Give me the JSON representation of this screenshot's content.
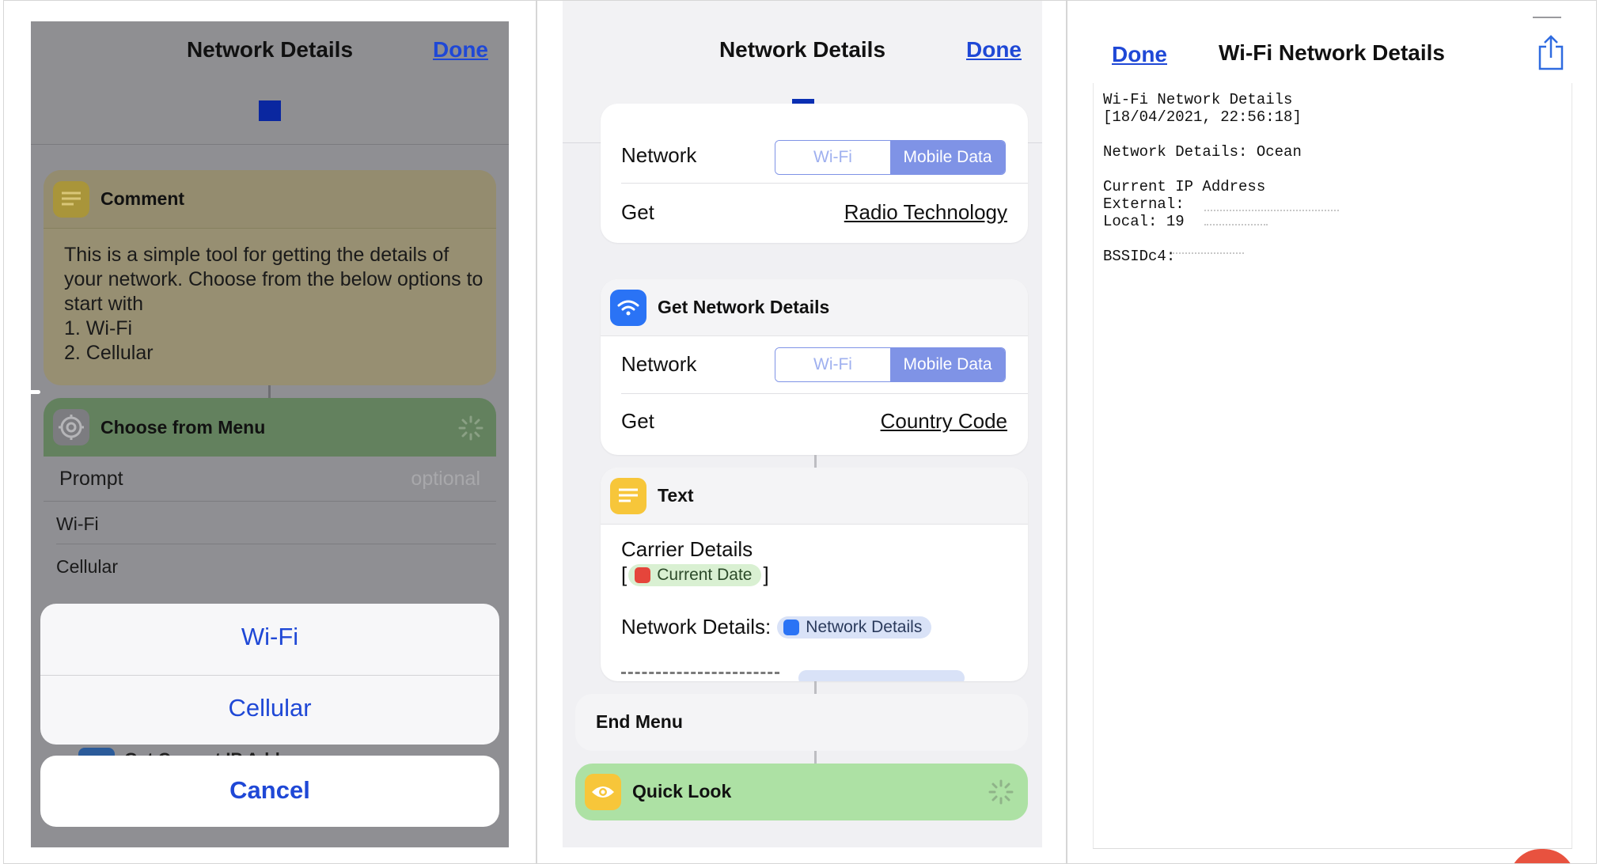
{
  "panel1": {
    "title": "Network Details",
    "done_label": "Done",
    "comment": {
      "title": "Comment",
      "text": "This is a simple tool for getting the details of your network. Choose from the below options to start with\n1. Wi-Fi\n2. Cellular"
    },
    "menu": {
      "title": "Choose from Menu",
      "prompt_label": "Prompt",
      "prompt_placeholder": "optional",
      "items": [
        "Wi-Fi",
        "Cellular"
      ]
    },
    "hidden_action": "Get Current IP Address",
    "action_sheet": {
      "options": [
        "Wi-Fi",
        "Cellular"
      ],
      "cancel_label": "Cancel"
    }
  },
  "panel2": {
    "title": "Network Details",
    "done_label": "Done",
    "top_card": {
      "network_label": "Network",
      "segments": [
        "Wi-Fi",
        "Mobile Data"
      ],
      "selected": "Mobile Data",
      "get_label": "Get",
      "get_value": "Radio Technology"
    },
    "network_card": {
      "title": "Get Network Details",
      "network_label": "Network",
      "segments": [
        "Wi-Fi",
        "Mobile Data"
      ],
      "selected": "Mobile Data",
      "get_label": "Get",
      "get_value": "Country Code"
    },
    "text_card": {
      "title": "Text",
      "line1": "Carrier Details",
      "bracket_open": "[",
      "date_token": "Current Date",
      "bracket_close": "]",
      "network_details_label": "Network Details:",
      "network_token": "Network Details"
    },
    "end_menu_label": "End Menu",
    "quick_look_label": "Quick Look",
    "colors": {
      "accent_blue": "#1f48d6",
      "segment_selected": "#7f93e6",
      "quick_look_green": "#ade1a4"
    }
  },
  "panel3": {
    "done_label": "Done",
    "title": "Wi-Fi Network Details",
    "share_icon": "share-icon",
    "lines": {
      "heading": "Wi-Fi Network Details",
      "timestamp": "[18/04/2021, 22:56:18]",
      "network_details": "Network Details: Ocean",
      "ip_heading": "Current IP Address",
      "external": "External:",
      "local": "Local: 19",
      "bssid": "BSSIDc4:"
    }
  }
}
